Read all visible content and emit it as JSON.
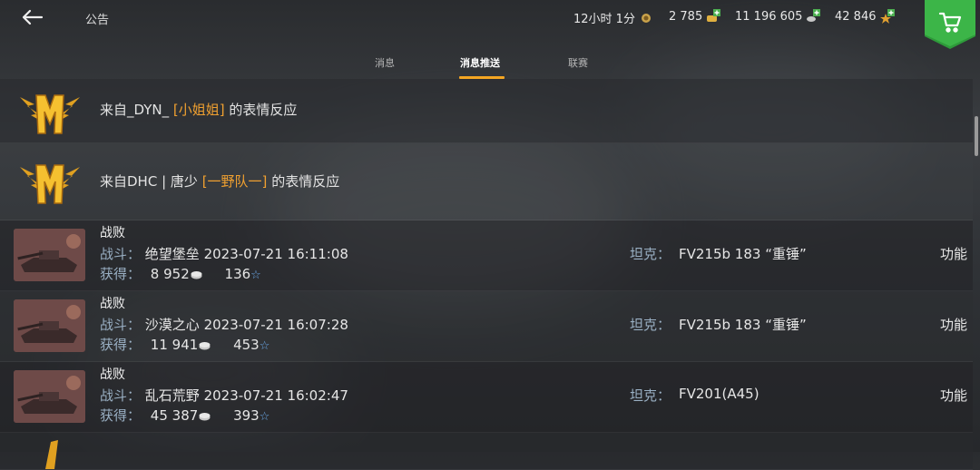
{
  "header": {
    "title": "公告",
    "timer": "12小时 1分",
    "gold": "2 785",
    "credits": "11 196 605",
    "free_xp": "42 846"
  },
  "tabs": [
    {
      "label": "消息",
      "active": false
    },
    {
      "label": "消息推送",
      "active": true
    },
    {
      "label": "联赛",
      "active": false
    }
  ],
  "reactions": [
    {
      "prefix": "来自_DYN_",
      "clan": "[小姐姐]",
      "suffix": "的表情反应"
    },
    {
      "prefix": "来自DHC | 唐少",
      "clan": "[一野队一]",
      "suffix": "的表情反应"
    }
  ],
  "labels": {
    "battle": "战斗：",
    "earned": "获得：",
    "tank": "坦克：",
    "function": "功能"
  },
  "battles": [
    {
      "result": "战败",
      "map": "绝望堡垒",
      "datetime": "2023-07-21 16:11:08",
      "credits": "8 952",
      "xp": "136",
      "tank": "FV215b 183 “重锤”"
    },
    {
      "result": "战败",
      "map": "沙漠之心",
      "datetime": "2023-07-21 16:07:28",
      "credits": "11 941",
      "xp": "453",
      "tank": "FV215b 183 “重锤”"
    },
    {
      "result": "战败",
      "map": "乱石荒野",
      "datetime": "2023-07-21 16:02:47",
      "credits": "45 387",
      "xp": "393",
      "tank": "FV201(A45)"
    }
  ],
  "colors": {
    "accent": "#f5a623",
    "clan": "#f0a030",
    "label": "#9ab0c4",
    "shop": "#2e9a3a"
  }
}
